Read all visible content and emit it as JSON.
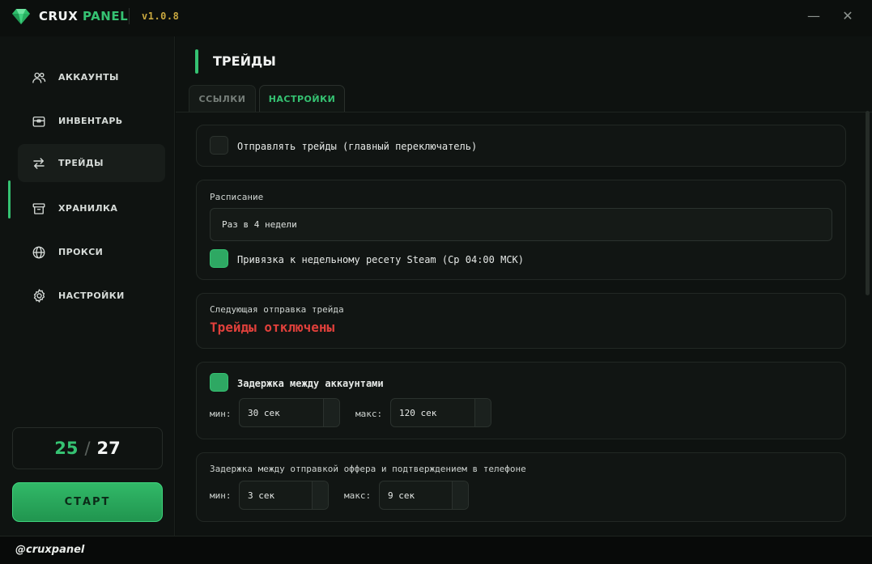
{
  "app": {
    "brand_part1": "CRUX",
    "brand_part2": "PANEL",
    "version": "v1.0.8",
    "accent_color": "#35c272",
    "minimize_glyph": "—",
    "close_glyph": "✕"
  },
  "sidebar": {
    "items": [
      {
        "label": "АККАУНТЫ",
        "icon": "users-icon"
      },
      {
        "label": "ИНВЕНТАРЬ",
        "icon": "inventory-icon"
      },
      {
        "label": "ТРЕЙДЫ",
        "icon": "swap-arrows-icon",
        "active": true
      },
      {
        "label": "ХРАНИЛКА",
        "icon": "archive-box-icon"
      },
      {
        "label": "ПРОКСИ",
        "icon": "globe-icon"
      },
      {
        "label": "НАСТРОЙКИ",
        "icon": "gear-icon"
      }
    ],
    "counter_current": "25",
    "counter_sep": "/",
    "counter_total": "27",
    "start_label": "СТАРТ"
  },
  "footer": {
    "handle": "@cruxpanel"
  },
  "page": {
    "title": "ТРЕЙДЫ",
    "tabs": [
      {
        "label": "ССЫЛКИ",
        "active": false
      },
      {
        "label": "НАСТРОЙКИ",
        "active": true
      }
    ]
  },
  "settings": {
    "send_trades_label": "Отправлять трейды (главный переключатель)",
    "send_trades_checked": false,
    "schedule_label": "Расписание",
    "schedule_value": "Раз в 4 недели",
    "steam_reset_label": "Привязка к недельному ресету Steam (Ср 04:00 МСК)",
    "steam_reset_checked": true,
    "next_send_label": "Следующая отправка трейда",
    "next_send_status": "Трейды отключены",
    "status_color": "#e0403b",
    "account_delay_label": "Задержка между аккаунтами",
    "account_delay_checked": true,
    "account_delay_min_label": "мин:",
    "account_delay_min": "30 сек",
    "account_delay_max_label": "макс:",
    "account_delay_max": "120 сек",
    "offer_delay_label": "Задержка между отправкой оффера и подтверждением в телефоне",
    "offer_delay_min_label": "мин:",
    "offer_delay_min": "3 сек",
    "offer_delay_max_label": "макс:",
    "offer_delay_max": "9 сек"
  }
}
